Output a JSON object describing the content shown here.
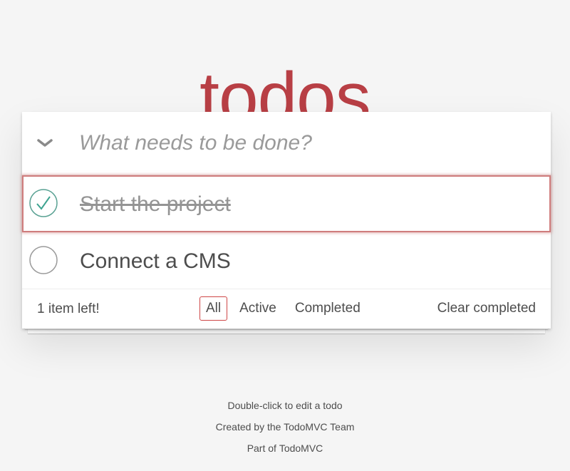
{
  "header": {
    "title": "todos"
  },
  "new_todo": {
    "value": "",
    "placeholder": "What needs to be done?"
  },
  "todos": [
    {
      "label": "Start the project",
      "completed": true
    },
    {
      "label": "Connect a CMS",
      "completed": false
    }
  ],
  "footer": {
    "count_text": "1 item left!",
    "filters": [
      {
        "label": "All",
        "selected": true
      },
      {
        "label": "Active",
        "selected": false
      },
      {
        "label": "Completed",
        "selected": false
      }
    ],
    "clear_label": "Clear completed"
  },
  "info": {
    "edit_hint": "Double-click to edit a todo",
    "created_by": "Created by the TodoMVC Team",
    "part_of_prefix": "Part of ",
    "part_of_link": "TodoMVC"
  },
  "colors": {
    "title": "#b83f45",
    "check": "#5dc2af",
    "selected_filter_border": "#ce4646",
    "focus_outline": "#cf7d7d"
  },
  "icons": {
    "toggle_all": "chevron-down-icon",
    "completed_check": "checkmark-circle-icon",
    "pending_check": "empty-circle-icon"
  }
}
